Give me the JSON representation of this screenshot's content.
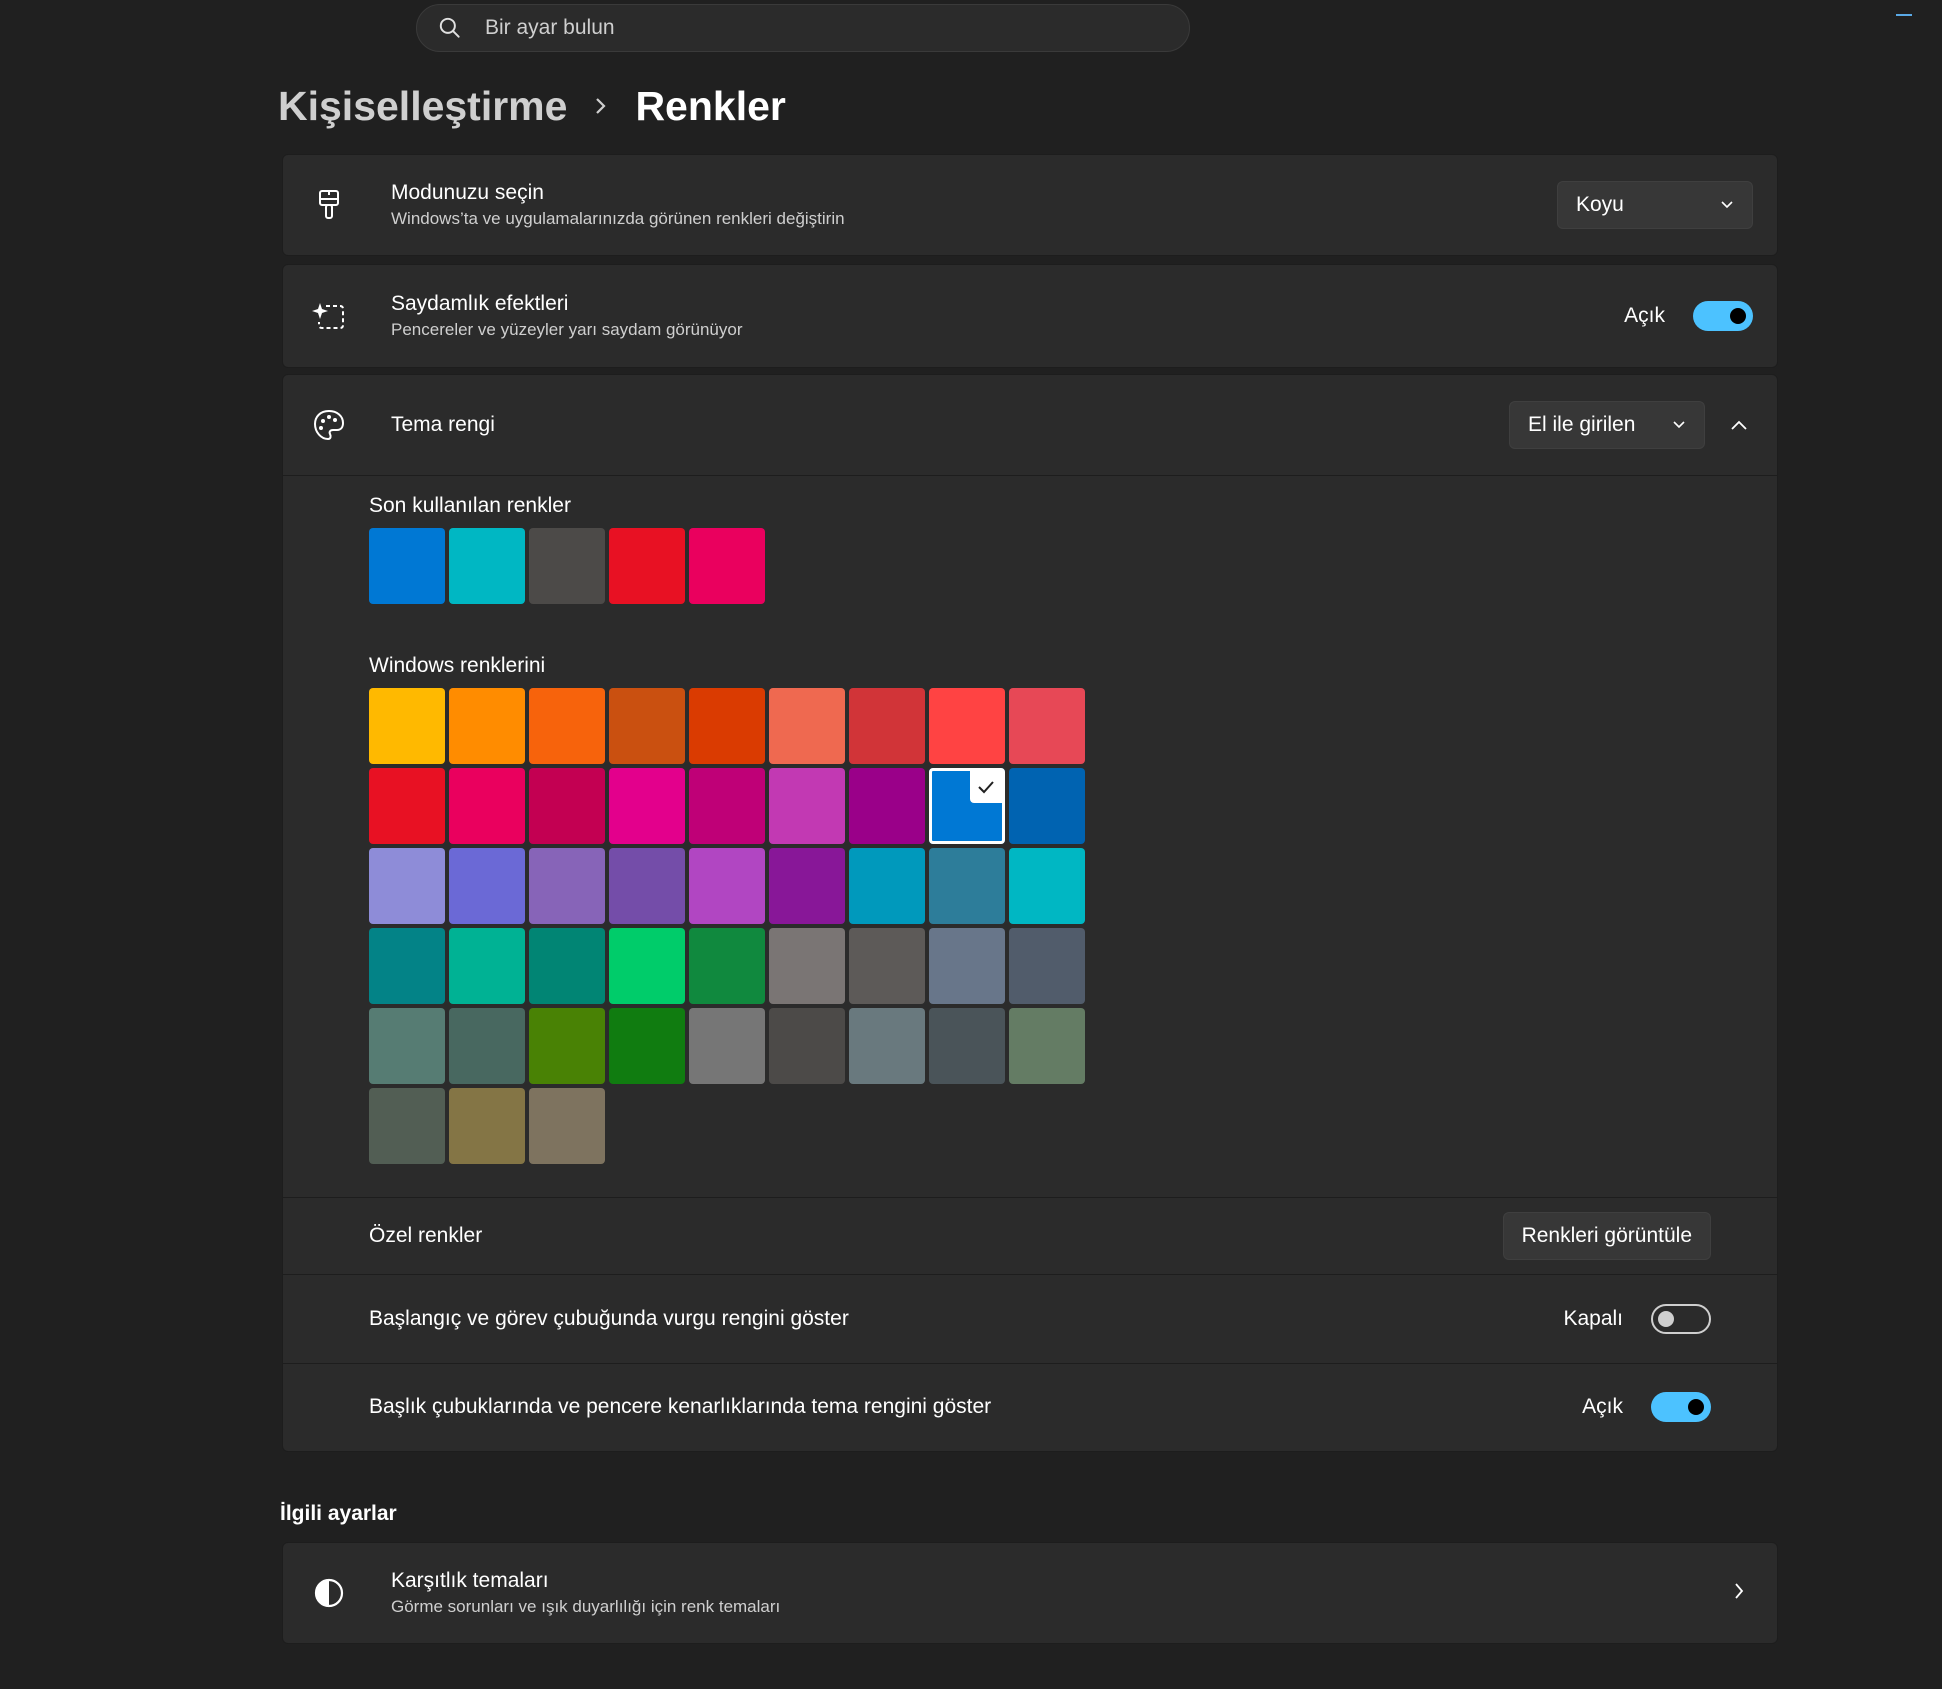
{
  "search": {
    "placeholder": "Bir ayar bulun"
  },
  "breadcrumb": {
    "parent": "Kişiselleştirme",
    "current": "Renkler"
  },
  "mode": {
    "title": "Modunuzu seçin",
    "subtitle": "Windows’ta ve uygulamalarınızda görünen renkleri değiştirin",
    "value": "Koyu",
    "icon": "paintbrush-icon"
  },
  "transparency": {
    "title": "Saydamlık efektleri",
    "subtitle": "Pencereler ve yüzeyler yarı saydam görünüyor",
    "state": "Açık",
    "on": true,
    "icon": "sparkle-selection-icon"
  },
  "accent": {
    "title": "Tema rengi",
    "value": "El ile girilen",
    "icon": "palette-icon",
    "recent_label": "Son kullanılan renkler",
    "recent_colors": [
      "#0078d4",
      "#00b7c3",
      "#4c4a48",
      "#e81123",
      "#ea005e"
    ],
    "windows_label": "Windows renklerini",
    "selected_index": 16,
    "windows_colors": [
      "#ffb900",
      "#ff8c00",
      "#f7630c",
      "#ca5010",
      "#da3b01",
      "#ef6950",
      "#d13438",
      "#ff4343",
      "#e74856",
      "#e81123",
      "#ea005e",
      "#c30052",
      "#e3008c",
      "#bf0077",
      "#c239b3",
      "#9a0089",
      "#0078d4",
      "#0063b1",
      "#8e8cd8",
      "#6b69d6",
      "#8764b8",
      "#744da9",
      "#b146c2",
      "#881798",
      "#0099bc",
      "#2d7d9a",
      "#00b7c3",
      "#038387",
      "#00b294",
      "#018574",
      "#00cc6a",
      "#10893e",
      "#7a7574",
      "#5d5a58",
      "#68768a",
      "#515c6b",
      "#567c73",
      "#486860",
      "#498205",
      "#107c10",
      "#767676",
      "#4c4a48",
      "#69797e",
      "#4a5459",
      "#647c64",
      "#525e54",
      "#847545",
      "#7e735f"
    ],
    "custom_label": "Özel renkler",
    "custom_button": "Renkleri görüntüle",
    "start_taskbar_label": "Başlangıç ve görev çubuğunda vurgu rengini göster",
    "start_taskbar_state": "Kapalı",
    "start_taskbar_on": false,
    "titlebar_label": "Başlık çubuklarında ve pencere kenarlıklarında tema rengini göster",
    "titlebar_state": "Açık",
    "titlebar_on": true
  },
  "related": {
    "heading": "İlgili ayarlar",
    "contrast_title": "Karşıtlık temaları",
    "contrast_subtitle": "Görme sorunları ve ışık duyarlılığı için renk temaları",
    "icon": "contrast-icon"
  }
}
